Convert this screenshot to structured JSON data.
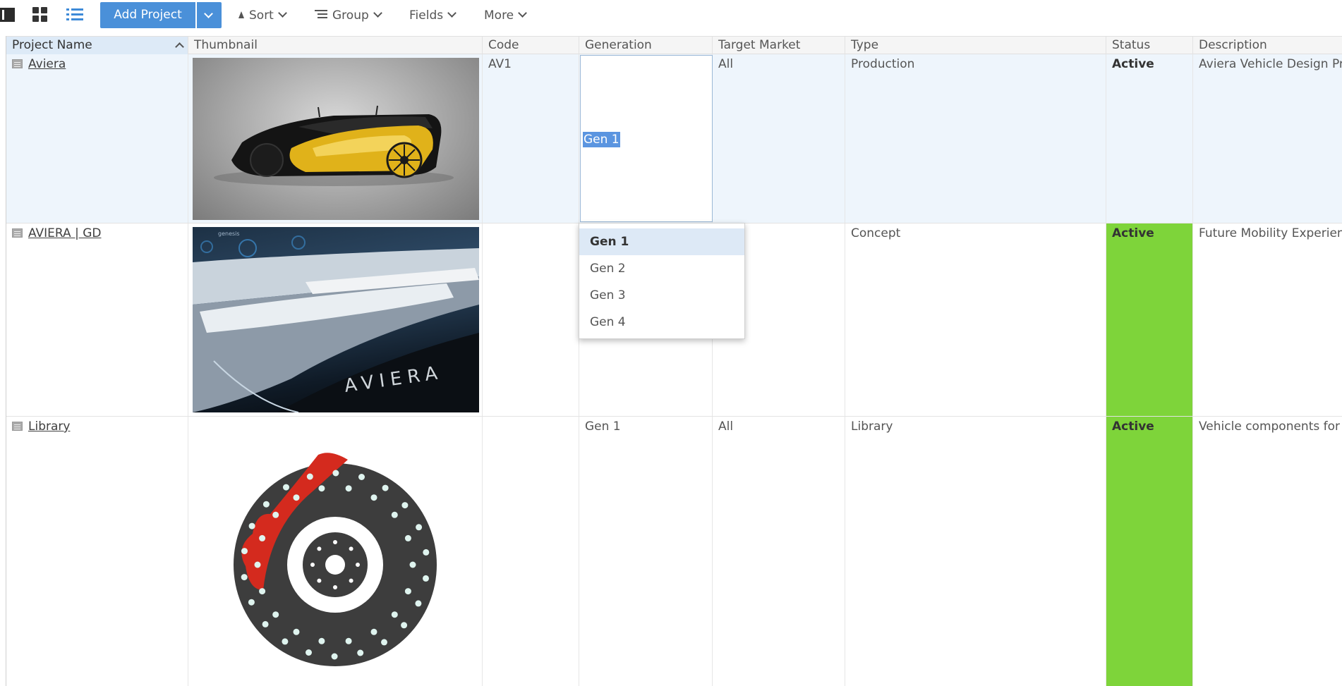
{
  "toolbar": {
    "add_project_label": "Add Project",
    "sort_label": "Sort",
    "group_label": "Group",
    "fields_label": "Fields",
    "more_label": "More"
  },
  "columns": [
    "Project Name",
    "Thumbnail",
    "Code",
    "Generation",
    "Target Market",
    "Type",
    "Status",
    "Description"
  ],
  "rows": [
    {
      "name": "Aviera",
      "code": "AV1",
      "generation": "Gen 1",
      "target_market": "All",
      "type": "Production",
      "status": "Active",
      "description": "Aviera Vehicle Design Pr"
    },
    {
      "name": "AVIERA | GD",
      "code": "",
      "generation": "",
      "target_market": "",
      "type": "Concept",
      "status": "Active",
      "description": "Future Mobility Experien"
    },
    {
      "name": "Library",
      "code": "",
      "generation": "Gen 1",
      "target_market": "All",
      "type": "Library",
      "status": "Active",
      "description": "Vehicle components for"
    }
  ],
  "dropdown": {
    "options": [
      "Gen 1",
      "Gen 2",
      "Gen 3",
      "Gen 4"
    ],
    "highlighted": "Gen 1"
  },
  "thumbnails": {
    "row2_brand_text": "AVIERA",
    "row2_screen_text": "genesis"
  },
  "colors": {
    "accent": "#4a90d9",
    "status_active_bg": "#7ed43a",
    "selected_row_bg": "#eef5fc",
    "caliper_red": "#d42a1e",
    "rotor_dark": "#3d3d3d",
    "car_yellow": "#e0b21a"
  }
}
